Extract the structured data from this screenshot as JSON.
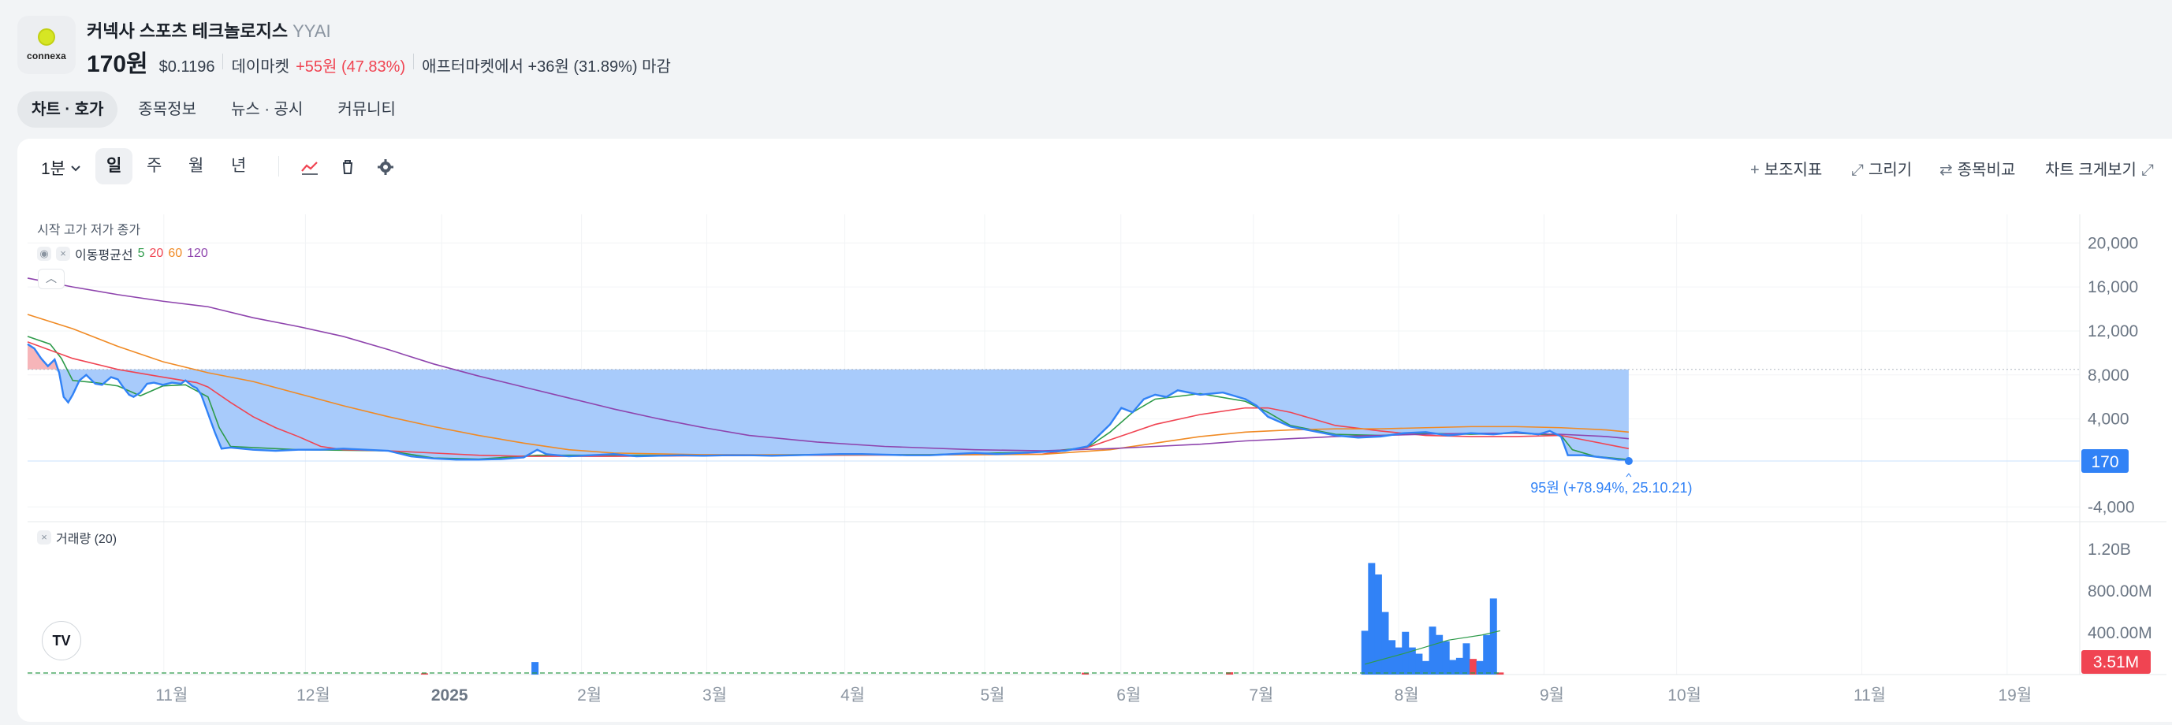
{
  "header": {
    "logo_text": "connexa",
    "name": "커넥사 스포츠 테크놀로지스",
    "ticker": "YYAI",
    "price": "170원",
    "usd_price": "$0.1196",
    "market": "데이마켓",
    "change": "+55원 (47.83%)",
    "after_market": "애프터마켓에서 +36원 (31.89%) 마감"
  },
  "tabs": [
    {
      "label": "차트 · 호가",
      "active": true
    },
    {
      "label": "종목정보",
      "active": false
    },
    {
      "label": "뉴스 · 공시",
      "active": false
    },
    {
      "label": "커뮤니티",
      "active": false
    }
  ],
  "toolbar": {
    "interval": "1분",
    "periods": [
      "일",
      "주",
      "월",
      "년"
    ],
    "active_period": "일",
    "icons": [
      "line-chart-icon",
      "trash-icon",
      "gear-icon"
    ],
    "right": [
      "보조지표",
      "그리기",
      "종목비교",
      "차트 크게보기"
    ]
  },
  "legend": {
    "ohlc": "시작 고가 저가 종가",
    "ma_label": "이동평균선",
    "ma_periods": [
      {
        "label": "5",
        "color": "#2e9b4a"
      },
      {
        "label": "20",
        "color": "#f04452"
      },
      {
        "label": "60",
        "color": "#f08a24"
      },
      {
        "label": "120",
        "color": "#8e44ad"
      }
    ],
    "volume": "거래량 (20)"
  },
  "chart_data": {
    "type": "area",
    "price_axis": {
      "ticks": [
        "20,000",
        "16,000",
        "12,000",
        "8,000",
        "4,000",
        "-4,000"
      ],
      "tick_values": [
        20000,
        16000,
        12000,
        8000,
        4000,
        -4000
      ],
      "current_label": "170",
      "current_value": 170
    },
    "volume_axis": {
      "ticks": [
        "1.20B",
        "800.00M",
        "400.00M"
      ],
      "tick_values": [
        1200000000,
        800000000,
        400000000
      ],
      "current_label": "3.51M",
      "current_value": 3510000
    },
    "x_ticks": [
      "11월",
      "12월",
      "2025",
      "2월",
      "3월",
      "4월",
      "5월",
      "6월",
      "7월",
      "8월",
      "9월",
      "10월",
      "11월",
      "19월"
    ],
    "baseline_value": 8500,
    "annotation": "95원 (+78.94%, 25.10.21)",
    "colors": {
      "area": "#a3c8fb",
      "line": "#3182f6",
      "negative_fill": "#f4a3a8",
      "ma5": "#2e9b4a",
      "ma20": "#f04452",
      "ma60": "#f08a24",
      "ma120": "#8e44ad",
      "up_bar": "#f04452",
      "down_bar": "#3182f6"
    },
    "series": [
      {
        "values": [
          [
            0,
            10800
          ],
          [
            0.3,
            10400
          ],
          [
            0.6,
            9500
          ],
          [
            0.9,
            8800
          ],
          [
            1.2,
            9400
          ],
          [
            1.4,
            8200
          ],
          [
            1.6,
            6000
          ],
          [
            1.8,
            5500
          ],
          [
            2.0,
            6200
          ],
          [
            2.3,
            7500
          ],
          [
            2.6,
            8000
          ],
          [
            3.0,
            7200
          ],
          [
            3.3,
            7100
          ],
          [
            3.7,
            7800
          ],
          [
            4.0,
            7600
          ],
          [
            4.2,
            7000
          ],
          [
            4.5,
            6200
          ],
          [
            4.7,
            6000
          ],
          [
            5.0,
            6400
          ],
          [
            5.3,
            7200
          ],
          [
            5.6,
            7300
          ],
          [
            6.0,
            7100
          ],
          [
            6.4,
            7300
          ],
          [
            6.8,
            7200
          ],
          [
            7.0,
            7500
          ],
          [
            7.3,
            7000
          ],
          [
            7.5,
            6800
          ],
          [
            7.7,
            6200
          ],
          [
            8.0,
            4500
          ],
          [
            8.3,
            2800
          ],
          [
            8.6,
            1300
          ],
          [
            9.0,
            1400
          ],
          [
            10,
            1200
          ],
          [
            11,
            1100
          ],
          [
            12,
            1200
          ],
          [
            13,
            1200
          ],
          [
            14,
            1300
          ],
          [
            15,
            1200
          ],
          [
            16,
            1100
          ],
          [
            17,
            600
          ],
          [
            18,
            400
          ],
          [
            19,
            300
          ],
          [
            20,
            300
          ],
          [
            21,
            350
          ],
          [
            22,
            500
          ],
          [
            22.6,
            1200
          ],
          [
            23,
            800
          ],
          [
            24,
            600
          ],
          [
            25,
            700
          ],
          [
            26,
            800
          ],
          [
            27,
            600
          ],
          [
            28,
            650
          ],
          [
            29,
            700
          ],
          [
            30,
            650
          ],
          [
            31,
            700
          ],
          [
            32,
            700
          ],
          [
            33,
            650
          ],
          [
            34,
            700
          ],
          [
            35,
            750
          ],
          [
            36,
            800
          ],
          [
            37,
            800
          ],
          [
            38,
            750
          ],
          [
            39,
            700
          ],
          [
            40,
            700
          ],
          [
            41,
            800
          ],
          [
            42,
            900
          ],
          [
            43,
            800
          ],
          [
            44,
            900
          ],
          [
            45,
            1000
          ],
          [
            46,
            1100
          ],
          [
            47,
            1500
          ],
          [
            48,
            3500
          ],
          [
            48.5,
            5000
          ],
          [
            49,
            4600
          ],
          [
            49.5,
            5800
          ],
          [
            50,
            6200
          ],
          [
            50.5,
            6000
          ],
          [
            51,
            6600
          ],
          [
            52,
            6200
          ],
          [
            53,
            6400
          ],
          [
            54,
            5800
          ],
          [
            54.5,
            5200
          ],
          [
            55,
            4200
          ],
          [
            56,
            3300
          ],
          [
            57,
            2900
          ],
          [
            58,
            2500
          ],
          [
            59,
            2300
          ],
          [
            60,
            2400
          ],
          [
            61,
            2700
          ],
          [
            62,
            2800
          ],
          [
            63,
            2500
          ],
          [
            64,
            2700
          ],
          [
            65,
            2600
          ],
          [
            66,
            2800
          ],
          [
            67,
            2600
          ],
          [
            67.5,
            2900
          ],
          [
            68,
            2400
          ],
          [
            68.3,
            700
          ],
          [
            69,
            700
          ],
          [
            70,
            450
          ],
          [
            71,
            170
          ]
        ]
      },
      {
        "name": "5",
        "values": [
          [
            0,
            11500
          ],
          [
            1,
            10800
          ],
          [
            1.5,
            9500
          ],
          [
            2,
            7500
          ],
          [
            3,
            7300
          ],
          [
            4,
            7000
          ],
          [
            5,
            6100
          ],
          [
            6,
            7000
          ],
          [
            7,
            7100
          ],
          [
            8,
            6000
          ],
          [
            8.5,
            3200
          ],
          [
            9,
            1500
          ],
          [
            12,
            1200
          ],
          [
            16,
            1100
          ],
          [
            18,
            450
          ],
          [
            20,
            350
          ],
          [
            22.6,
            700
          ],
          [
            25,
            700
          ],
          [
            30,
            700
          ],
          [
            35,
            750
          ],
          [
            40,
            750
          ],
          [
            45,
            1000
          ],
          [
            47,
            1400
          ],
          [
            48,
            2800
          ],
          [
            49,
            4600
          ],
          [
            50,
            5800
          ],
          [
            52,
            6300
          ],
          [
            54,
            5600
          ],
          [
            55,
            4600
          ],
          [
            56,
            3400
          ],
          [
            58,
            2600
          ],
          [
            60,
            2500
          ],
          [
            62,
            2700
          ],
          [
            64,
            2600
          ],
          [
            66,
            2700
          ],
          [
            68,
            2500
          ],
          [
            68.5,
            1200
          ],
          [
            69.5,
            600
          ],
          [
            71,
            300
          ]
        ]
      },
      {
        "name": "20",
        "values": [
          [
            0,
            11000
          ],
          [
            2,
            9500
          ],
          [
            4,
            8500
          ],
          [
            6,
            7800
          ],
          [
            7.5,
            7300
          ],
          [
            8,
            6900
          ],
          [
            9,
            5500
          ],
          [
            10,
            4200
          ],
          [
            11,
            3200
          ],
          [
            12,
            2400
          ],
          [
            13,
            1500
          ],
          [
            14,
            1200
          ],
          [
            16,
            1100
          ],
          [
            18,
            900
          ],
          [
            20,
            700
          ],
          [
            22,
            600
          ],
          [
            26,
            600
          ],
          [
            30,
            650
          ],
          [
            35,
            700
          ],
          [
            40,
            720
          ],
          [
            45,
            800
          ],
          [
            47,
            1400
          ],
          [
            48,
            2100
          ],
          [
            49,
            2800
          ],
          [
            50,
            3500
          ],
          [
            52,
            4400
          ],
          [
            54,
            5000
          ],
          [
            55,
            5000
          ],
          [
            56,
            4600
          ],
          [
            57,
            4000
          ],
          [
            58,
            3400
          ],
          [
            60,
            2900
          ],
          [
            62,
            2500
          ],
          [
            64,
            2400
          ],
          [
            66,
            2400
          ],
          [
            68,
            2500
          ],
          [
            69,
            2100
          ],
          [
            71,
            1300
          ]
        ]
      },
      {
        "name": "60",
        "values": [
          [
            0,
            13500
          ],
          [
            2,
            12200
          ],
          [
            4,
            10600
          ],
          [
            6,
            9200
          ],
          [
            8,
            8200
          ],
          [
            10,
            7400
          ],
          [
            12,
            6300
          ],
          [
            14,
            5200
          ],
          [
            16,
            4200
          ],
          [
            18,
            3300
          ],
          [
            20,
            2500
          ],
          [
            22,
            1800
          ],
          [
            24,
            1200
          ],
          [
            26,
            900
          ],
          [
            30,
            750
          ],
          [
            35,
            730
          ],
          [
            40,
            730
          ],
          [
            45,
            780
          ],
          [
            48,
            1200
          ],
          [
            50,
            1800
          ],
          [
            52,
            2400
          ],
          [
            54,
            2800
          ],
          [
            56,
            3000
          ],
          [
            58,
            3100
          ],
          [
            60,
            3100
          ],
          [
            62,
            3200
          ],
          [
            64,
            3300
          ],
          [
            66,
            3300
          ],
          [
            68,
            3200
          ],
          [
            70,
            3000
          ],
          [
            71,
            2800
          ]
        ]
      },
      {
        "name": "120",
        "values": [
          [
            0,
            16800
          ],
          [
            2,
            16000
          ],
          [
            4,
            15300
          ],
          [
            6,
            14700
          ],
          [
            8,
            14200
          ],
          [
            10,
            13200
          ],
          [
            12,
            12400
          ],
          [
            14,
            11500
          ],
          [
            16,
            10300
          ],
          [
            18,
            9000
          ],
          [
            20,
            7900
          ],
          [
            22,
            6900
          ],
          [
            24,
            5900
          ],
          [
            26,
            4900
          ],
          [
            28,
            4000
          ],
          [
            30,
            3200
          ],
          [
            32,
            2500
          ],
          [
            35,
            1900
          ],
          [
            38,
            1500
          ],
          [
            42,
            1200
          ],
          [
            45,
            1100
          ],
          [
            48,
            1300
          ],
          [
            50,
            1500
          ],
          [
            52,
            1700
          ],
          [
            54,
            2000
          ],
          [
            56,
            2200
          ],
          [
            58,
            2400
          ],
          [
            60,
            2500
          ],
          [
            62,
            2600
          ],
          [
            64,
            2700
          ],
          [
            66,
            2700
          ],
          [
            68,
            2600
          ],
          [
            70,
            2400
          ],
          [
            71,
            2200
          ]
        ]
      }
    ],
    "volume": [
      {
        "x": 17.6,
        "v": 12000000,
        "up": true
      },
      {
        "x": 22.5,
        "v": 120000000,
        "up": false
      },
      {
        "x": 46.9,
        "v": 18000000,
        "up": true
      },
      {
        "x": 53.3,
        "v": 22000000,
        "up": true
      },
      {
        "x": 59.3,
        "v": 420000000,
        "up": false
      },
      {
        "x": 59.6,
        "v": 1070000000,
        "up": false
      },
      {
        "x": 59.9,
        "v": 960000000,
        "up": false
      },
      {
        "x": 60.2,
        "v": 600000000,
        "up": false
      },
      {
        "x": 60.5,
        "v": 330000000,
        "up": false
      },
      {
        "x": 60.8,
        "v": 260000000,
        "up": false
      },
      {
        "x": 61.1,
        "v": 410000000,
        "up": false
      },
      {
        "x": 61.4,
        "v": 260000000,
        "up": false
      },
      {
        "x": 61.7,
        "v": 200000000,
        "up": false
      },
      {
        "x": 62.0,
        "v": 130000000,
        "up": false
      },
      {
        "x": 62.3,
        "v": 460000000,
        "up": false
      },
      {
        "x": 62.6,
        "v": 380000000,
        "up": false
      },
      {
        "x": 62.9,
        "v": 320000000,
        "up": false
      },
      {
        "x": 63.2,
        "v": 140000000,
        "up": false
      },
      {
        "x": 63.5,
        "v": 160000000,
        "up": false
      },
      {
        "x": 63.8,
        "v": 300000000,
        "up": false
      },
      {
        "x": 64.1,
        "v": 150000000,
        "up": true
      },
      {
        "x": 64.4,
        "v": 130000000,
        "up": false
      },
      {
        "x": 64.7,
        "v": 380000000,
        "up": false
      },
      {
        "x": 65.0,
        "v": 730000000,
        "up": false
      },
      {
        "x": 65.3,
        "v": 20000000,
        "up": true
      }
    ]
  }
}
